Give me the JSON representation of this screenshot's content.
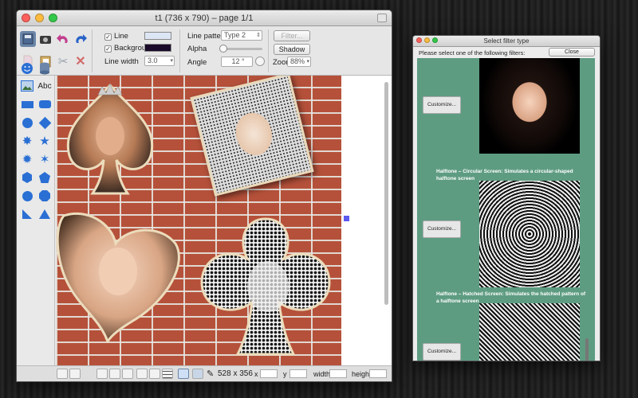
{
  "main_window": {
    "title": "t1 (736 x 790) – page 1/1",
    "toolbar": {
      "line_label": "Line",
      "background_label": "Background",
      "line_width_label": "Line width",
      "line_width_value": "3.0",
      "line_pattern_label": "Line pattern",
      "line_pattern_value": "Type 2",
      "alpha_label": "Alpha",
      "angle_label": "Angle",
      "angle_value": "12 °",
      "filter_button": "Filter...",
      "shadow_button": "Shadow",
      "zoom_label": "Zoom",
      "zoom_value": "88%",
      "abc_label": "Abc",
      "colors": {
        "line": "#dde6f4",
        "background": "#1a0a2a"
      }
    },
    "statusbar": {
      "size_text": "528 x 356",
      "x_label": "x",
      "y_label": "y",
      "width_label": "width",
      "height_label": "height"
    }
  },
  "filter_window": {
    "title": "Select filter type",
    "prompt": "Please select one of the following filters:",
    "close_button": "Close",
    "items": [
      {
        "button": "Customize...",
        "description": ""
      },
      {
        "button": "Customize...",
        "description": "Halftone – Circular Screen: Simulates a circular-shaped halftone screen"
      },
      {
        "button": "Customize...",
        "description": "Halftone – Hatched Screen: Simulates the hatched pattern of a halftone screen"
      }
    ],
    "list_color": "#5e9c82"
  }
}
